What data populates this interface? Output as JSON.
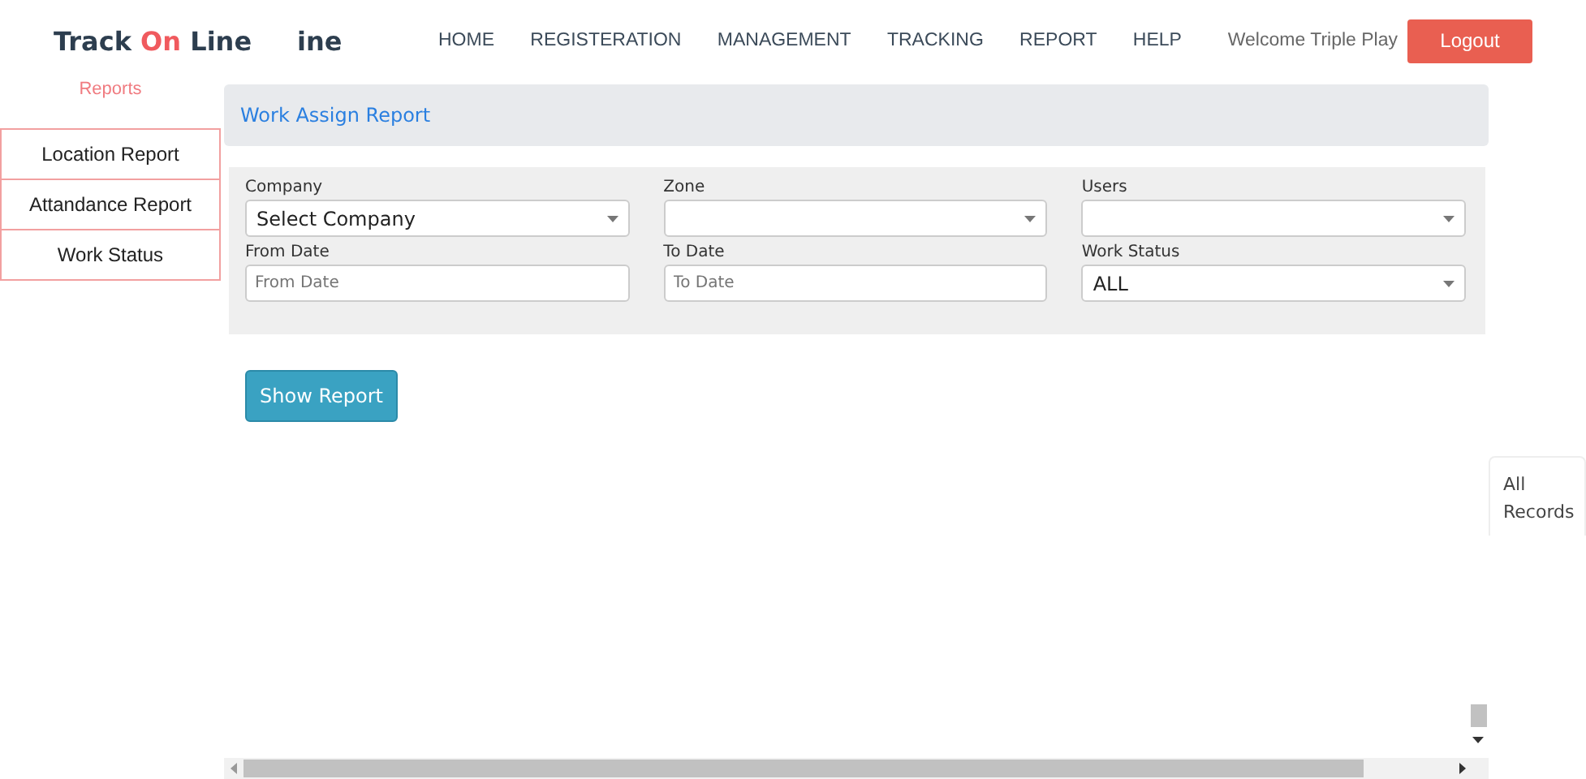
{
  "logo": {
    "first": "Track",
    "accent": "On",
    "last": "Line",
    "tail": "ine"
  },
  "nav": [
    {
      "label": "HOME"
    },
    {
      "label": "REGISTERATION"
    },
    {
      "label": "MANAGEMENT"
    },
    {
      "label": "TRACKING"
    },
    {
      "label": "REPORT"
    },
    {
      "label": "HELP"
    }
  ],
  "welcome": "Welcome Triple Play",
  "logout": "Logout",
  "sidebar": {
    "title": "Reports",
    "items": [
      {
        "label": "Location Report"
      },
      {
        "label": "Attandance Report"
      },
      {
        "label": "Work Status"
      }
    ]
  },
  "panel_title": "Work Assign Report",
  "fields": [
    {
      "kind": "select",
      "label": "Company",
      "value": "Select Company"
    },
    {
      "kind": "select",
      "label": "Zone"
    },
    {
      "kind": "select",
      "label": "Users"
    },
    {
      "kind": "input",
      "label": "From Date",
      "placeholder": "From Date"
    },
    {
      "kind": "input",
      "label": "To Date",
      "placeholder": "To Date"
    },
    {
      "kind": "select",
      "label": "Work Status",
      "value": "ALL"
    }
  ],
  "show_button": "Show Report",
  "side_tab": "All Records"
}
